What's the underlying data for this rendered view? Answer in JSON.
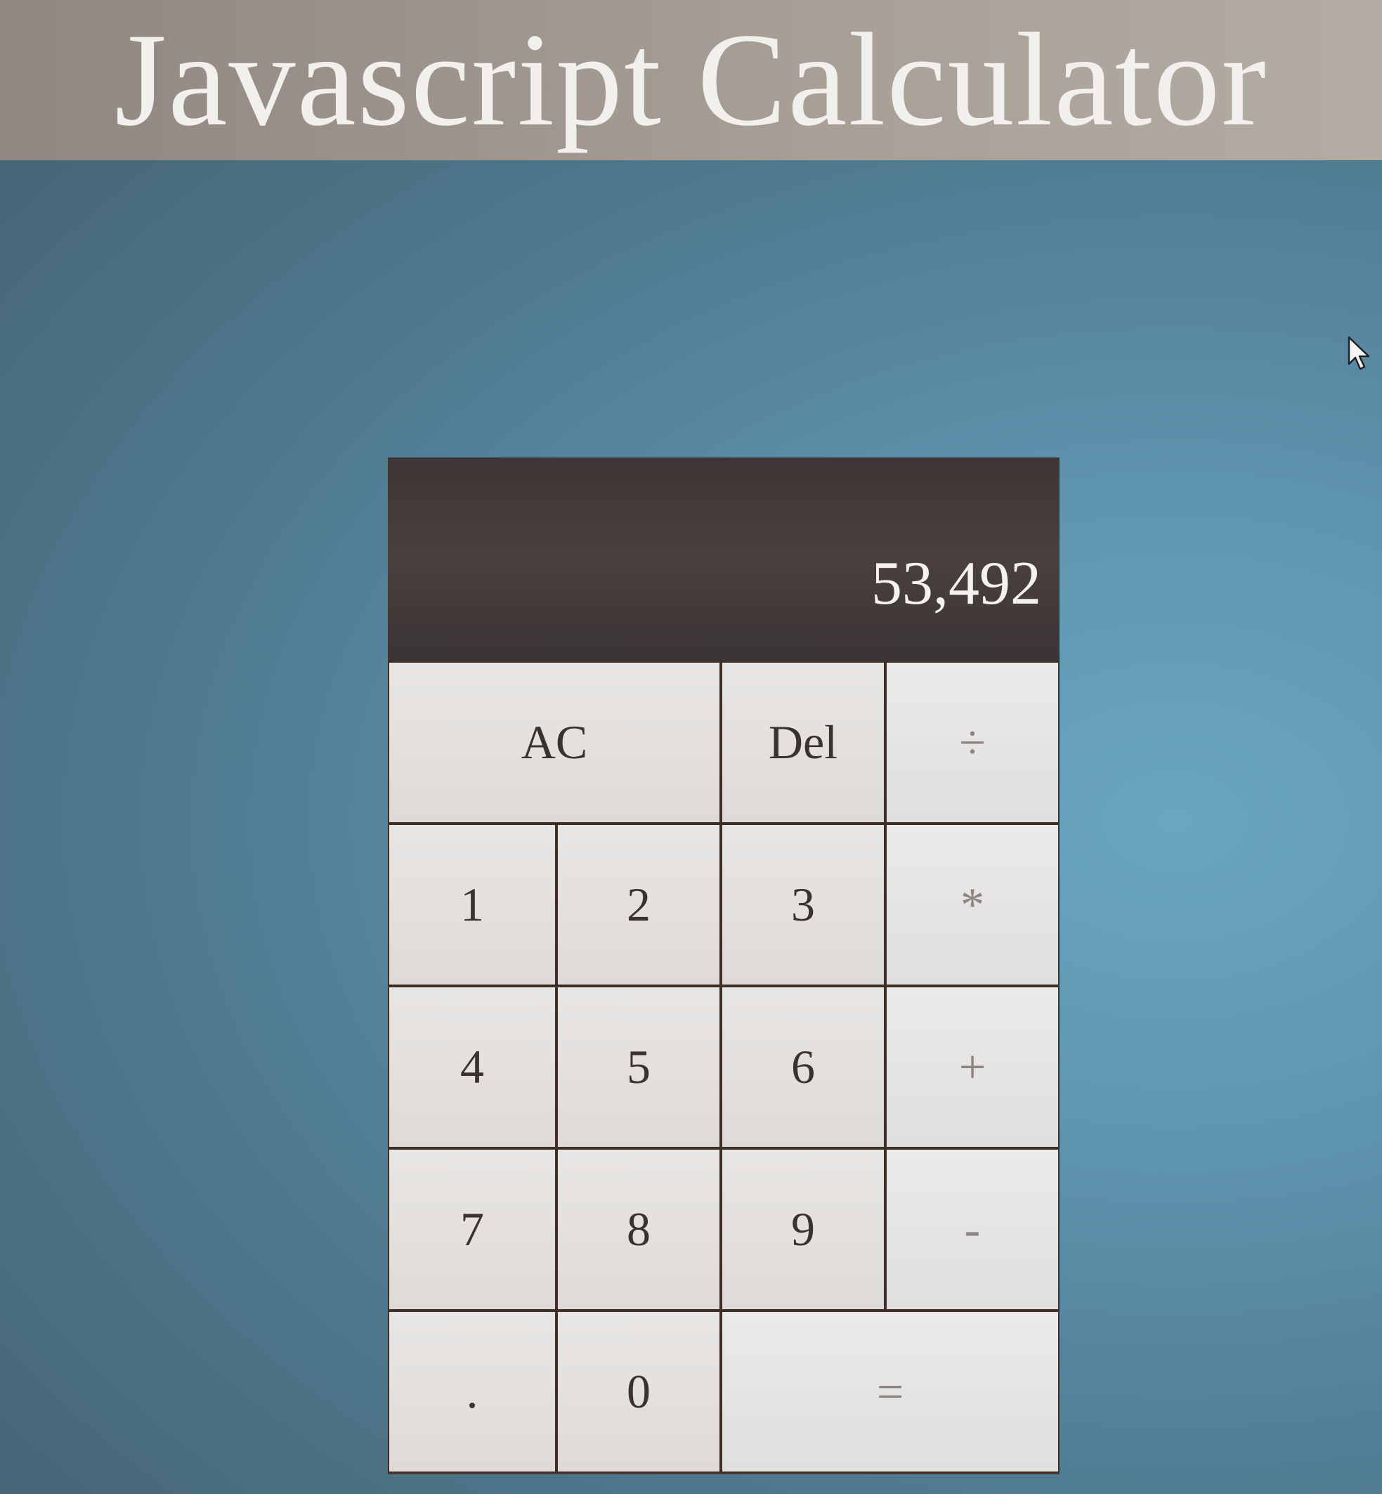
{
  "page": {
    "title": "Javascript Calculator"
  },
  "display": {
    "value": "53,492"
  },
  "keys": {
    "clear": "AC",
    "delete": "Del",
    "divide": "÷",
    "one": "1",
    "two": "2",
    "three": "3",
    "multiply": "*",
    "four": "4",
    "five": "5",
    "six": "6",
    "add": "+",
    "seven": "7",
    "eight": "8",
    "nine": "9",
    "subtract": "-",
    "decimal": ".",
    "zero": "0",
    "equals": "="
  },
  "icons": {
    "cursor": "mouse-pointer-icon"
  },
  "colors": {
    "display_bg": "#453b3b",
    "key_bg": "#e4e2e0",
    "key_border": "#3e2e26",
    "header_bg": "#a8a097",
    "page_bg": "#5a8ba3"
  }
}
